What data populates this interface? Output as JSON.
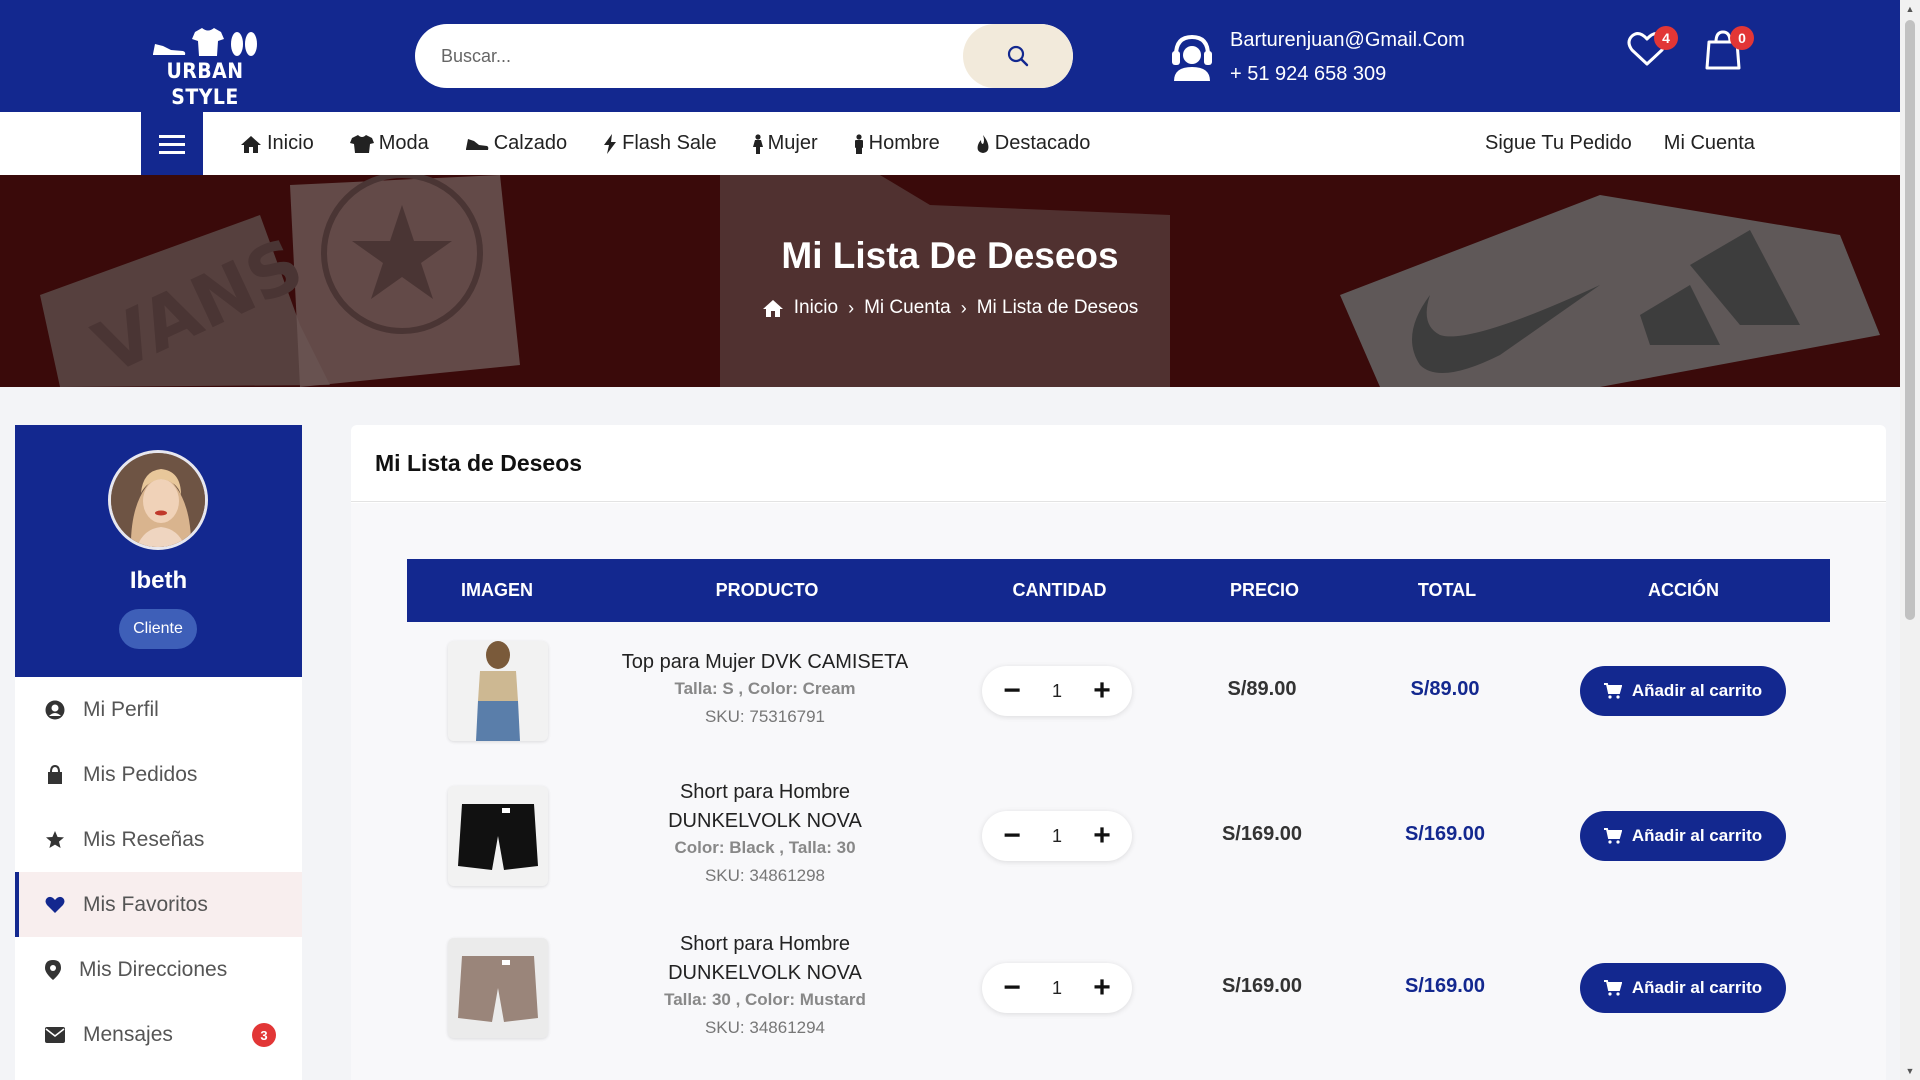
{
  "header": {
    "logo_text": "URBAN STYLE",
    "search_placeholder": "Buscar...",
    "contact_email": "Barturenjuan@Gmail.Com",
    "contact_phone": "+ 51 924 658 309",
    "wishlist_count": "4",
    "cart_count": "0"
  },
  "nav": {
    "links": [
      {
        "label": "Inicio",
        "icon": "home-icon"
      },
      {
        "label": "Moda",
        "icon": "tshirt-icon"
      },
      {
        "label": "Calzado",
        "icon": "shoe-icon"
      },
      {
        "label": "Flash Sale",
        "icon": "bolt-icon"
      },
      {
        "label": "Mujer",
        "icon": "female-icon"
      },
      {
        "label": "Hombre",
        "icon": "male-icon"
      },
      {
        "label": "Destacado",
        "icon": "fire-icon"
      }
    ],
    "right": [
      "Sigue Tu Pedido",
      "Mi Cuenta"
    ]
  },
  "hero": {
    "title": "Mi Lista De Deseos",
    "breadcrumb": [
      "Inicio",
      "Mi Cuenta",
      "Mi Lista de Deseos"
    ]
  },
  "sidebar": {
    "user_name": "Ibeth",
    "role": "Cliente",
    "items": [
      {
        "label": "Mi Perfil",
        "icon": "user-circle-icon"
      },
      {
        "label": "Mis Pedidos",
        "icon": "shopping-bag-icon"
      },
      {
        "label": "Mis Reseñas",
        "icon": "star-icon"
      },
      {
        "label": "Mis Favoritos",
        "icon": "heart-icon"
      },
      {
        "label": "Mis Direcciones",
        "icon": "map-pin-icon"
      },
      {
        "label": "Mensajes",
        "icon": "envelope-icon",
        "badge": "3"
      }
    ]
  },
  "wishlist": {
    "title": "Mi Lista de Deseos",
    "columns": [
      "IMAGEN",
      "PRODUCTO",
      "CANTIDAD",
      "PRECIO",
      "TOTAL",
      "ACCIÓN"
    ],
    "add_label": "Añadir al carrito",
    "items": [
      {
        "name": "Top para Mujer DVK CAMISETA",
        "attrs": "Talla: S , Color: Cream",
        "sku": "SKU: 75316791",
        "qty": "1",
        "price": "S/89.00",
        "total": "S/89.00"
      },
      {
        "name": "Short para Hombre DUNKELVOLK NOVA",
        "attrs": "Color: Black , Talla: 30",
        "sku": "SKU: 34861298",
        "qty": "1",
        "price": "S/169.00",
        "total": "S/169.00"
      },
      {
        "name": "Short para Hombre DUNKELVOLK NOVA",
        "attrs": "Talla: 30 , Color: Mustard",
        "sku": "SKU: 34861294",
        "qty": "1",
        "price": "S/169.00",
        "total": "S/169.00"
      }
    ]
  },
  "colors": {
    "primary": "#13288f",
    "hero_bg": "#3a0a0a",
    "badge": "#e23636"
  }
}
